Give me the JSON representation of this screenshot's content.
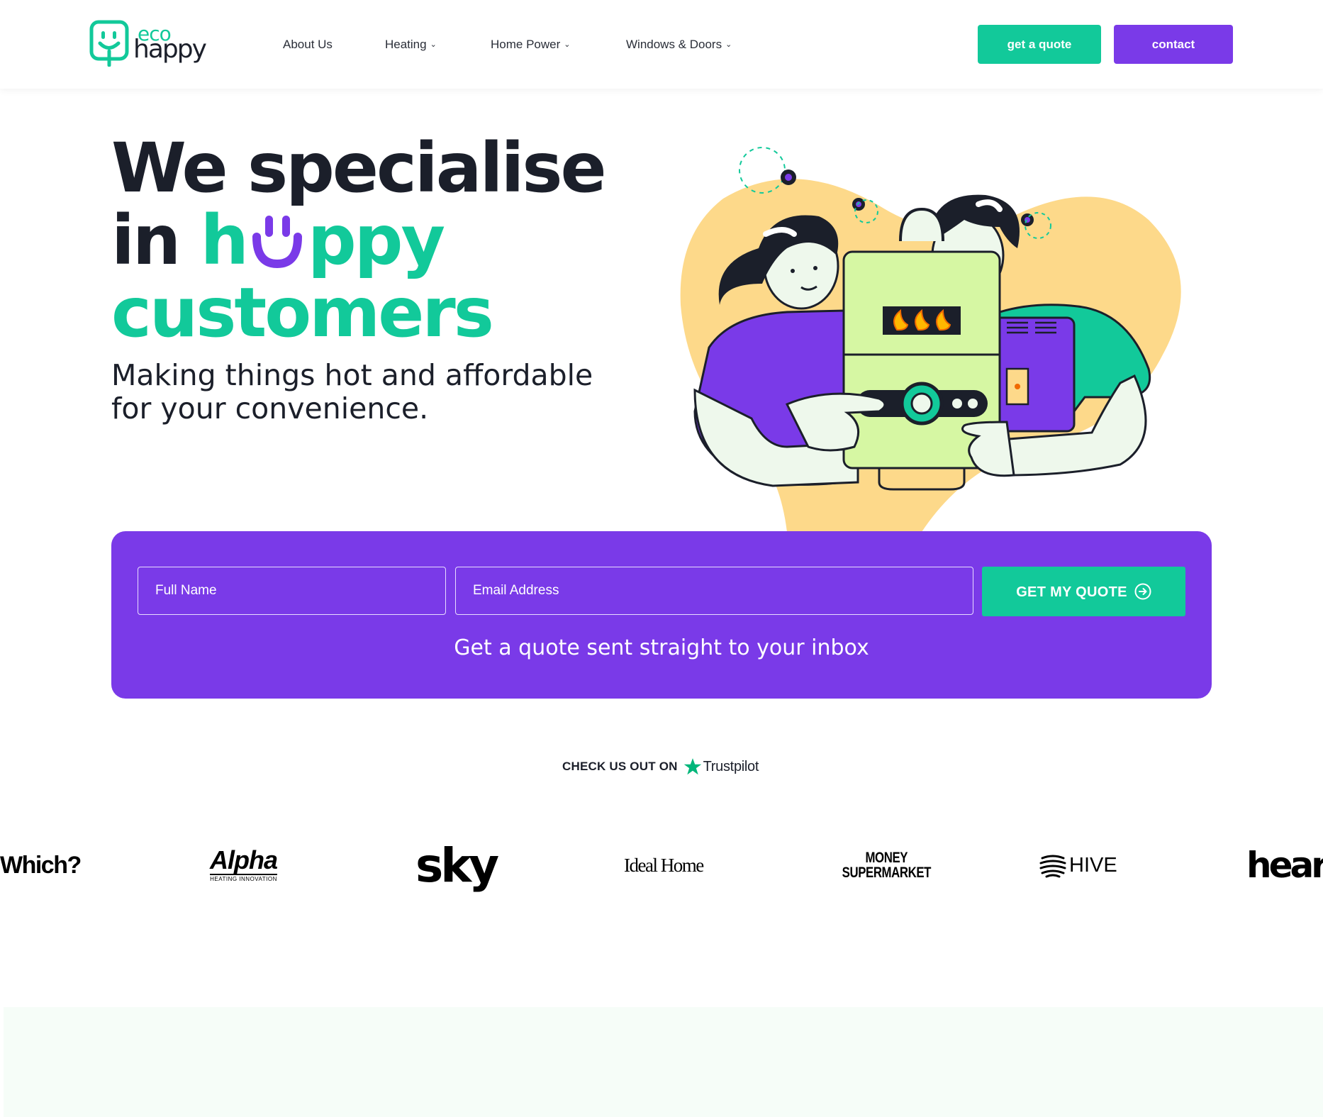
{
  "header": {
    "logo": {
      "eco": "eco",
      "happy": "happy"
    },
    "nav": [
      {
        "label": "About Us",
        "has_dropdown": false
      },
      {
        "label": "Heating",
        "has_dropdown": true
      },
      {
        "label": "Home Power",
        "has_dropdown": true
      },
      {
        "label": "Windows & Doors",
        "has_dropdown": true
      }
    ],
    "quote_button": "get a quote",
    "contact_button": "contact"
  },
  "hero": {
    "line1": "We specialise",
    "line2_prefix": "in ",
    "line2_h": "h",
    "line2_rest": "ppy",
    "line3": "customers",
    "sub_line1": "Making things hot and affordable",
    "sub_line2": "for your convenience."
  },
  "quote_form": {
    "name_placeholder": "Full Name",
    "email_placeholder": "Email Address",
    "submit_label": "GET MY QUOTE",
    "caption": "Get a quote sent straight to your inbox"
  },
  "trustpilot": {
    "label": "CHECK US OUT ON",
    "brand": "Trustpilot"
  },
  "brands": [
    {
      "name": "Which?"
    },
    {
      "name": "Alpha",
      "tagline": "HEATING INNOVATION"
    },
    {
      "name": "sky"
    },
    {
      "name": "Ideal Home"
    },
    {
      "name": "Money",
      "name2": "SuperMarket"
    },
    {
      "name": "HIVE"
    },
    {
      "name": "heart"
    }
  ],
  "colors": {
    "brand_green": "#12c99a",
    "brand_purple": "#7a3ae8",
    "dark_text": "#1b1f2a",
    "illustration_yellow": "#fdd98a",
    "illustration_lime": "#d6f7a3",
    "bottom_band": "#f6fdf8"
  },
  "icons": [
    "logo-smile-icon",
    "chevron-down-icon",
    "arrow-right-circle-icon",
    "trustpilot-star-icon",
    "hive-icon"
  ]
}
